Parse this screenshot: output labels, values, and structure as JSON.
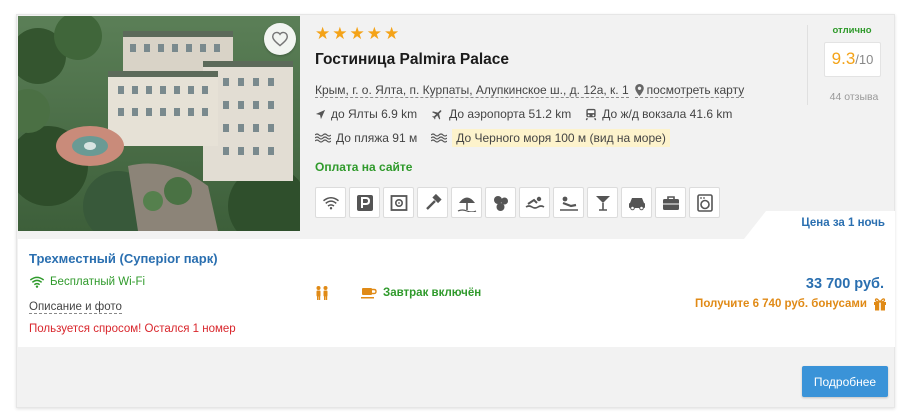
{
  "hotel": {
    "stars": [
      "★",
      "★",
      "★",
      "★",
      "★"
    ],
    "name": "Гостиница Palmira Palace",
    "address": "Крым, г. о. Ялта, п. Курпаты, Алупкинское ш., д. 12а, к. 1",
    "map_link": "посмотреть карту",
    "distances": {
      "city": "до Ялты 6.9 km",
      "airport": "До аэропорта 51.2 km",
      "station": "До ж/д вокзала 41.6 km",
      "beach": "До пляжа 91 м",
      "sea": "До Черного моря 100 м (вид на море)"
    },
    "payment": "Оплата на сайте",
    "amenities": [
      "wifi-icon",
      "parking-icon",
      "safe-icon",
      "hammer-icon",
      "beach-umbrella-icon",
      "spa-icon",
      "swimming-icon",
      "sauna-icon",
      "bar-icon",
      "car-icon",
      "luggage-icon",
      "washer-icon"
    ]
  },
  "rating": {
    "label": "отлично",
    "value": "9.3",
    "max": "/10",
    "reviews": "44 отзыва"
  },
  "price_tab": "Цена за 1 ночь",
  "room": {
    "name": "Трехместный (Суперior парк)",
    "wifi": "Бесплатный Wi-Fi",
    "description_link": "Описание и фото",
    "demand": "Пользуется спросом! Остался 1 номер",
    "breakfast": "Завтрак включён",
    "price": "33 700 руб.",
    "bonus": "Получите 6 740 руб. бонусами"
  },
  "button": {
    "more": "Подробнее"
  },
  "colors": {
    "accent": "#2a6fb0",
    "green": "#2f9a2b",
    "orange": "#e08a16",
    "star": "#f4a318",
    "red": "#d9262c",
    "button": "#3a93d8"
  }
}
